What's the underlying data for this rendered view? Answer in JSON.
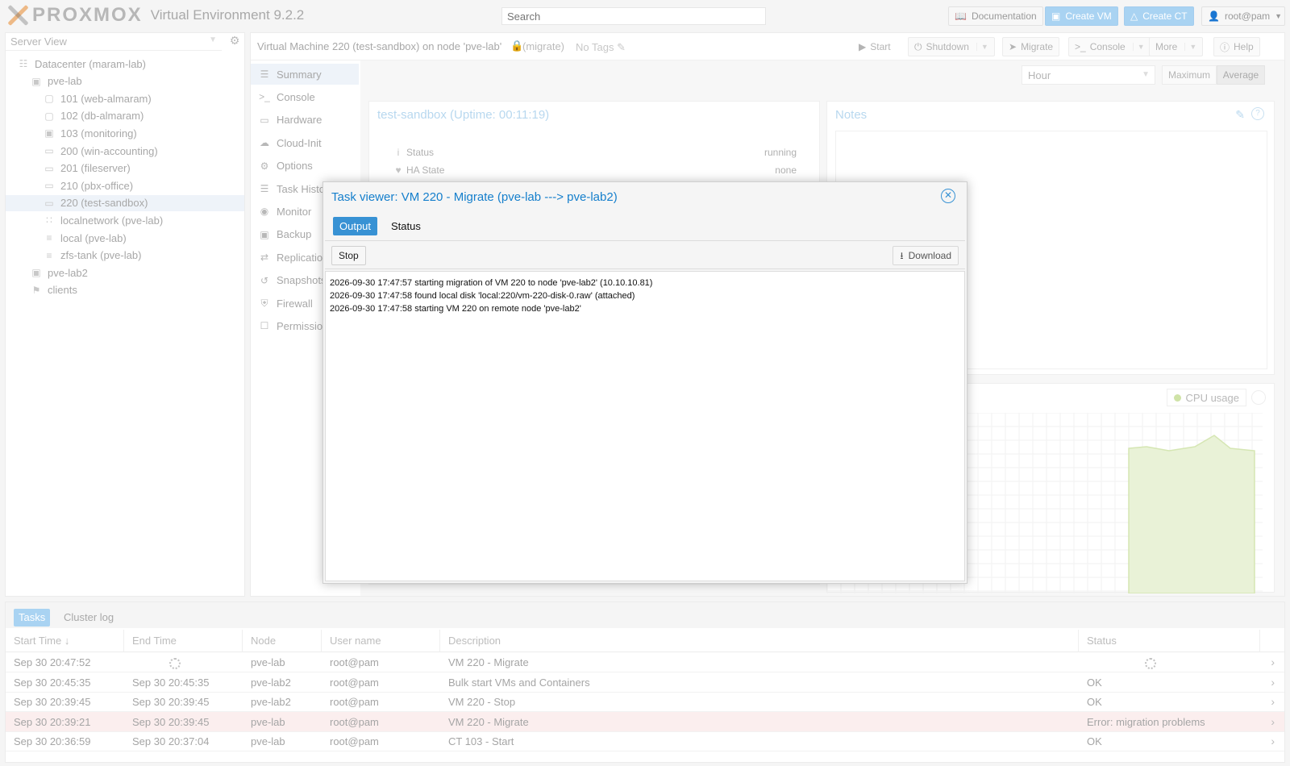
{
  "topbar": {
    "brand": "PROXMOX",
    "version": "Virtual Environment 9.2.2",
    "search_placeholder": "Search",
    "documentation": "Documentation",
    "create_vm": "Create VM",
    "create_ct": "Create CT",
    "user": "root@pam"
  },
  "tree": {
    "view": "Server View",
    "items": [
      {
        "label": "Datacenter (maram-lab)",
        "icon": "datacenter-icon"
      },
      {
        "label": "pve-lab",
        "icon": "node-online-icon"
      },
      {
        "label": "101 (web-almaram)",
        "icon": "container-icon"
      },
      {
        "label": "102 (db-almaram)",
        "icon": "container-icon"
      },
      {
        "label": "103 (monitoring)",
        "icon": "container-running-icon"
      },
      {
        "label": "200 (win-accounting)",
        "icon": "vm-icon"
      },
      {
        "label": "201 (fileserver)",
        "icon": "vm-icon"
      },
      {
        "label": "210 (pbx-office)",
        "icon": "vm-icon"
      },
      {
        "label": "220 (test-sandbox)",
        "icon": "vm-migrating-icon"
      },
      {
        "label": "localnetwork (pve-lab)",
        "icon": "network-icon"
      },
      {
        "label": "local (pve-lab)",
        "icon": "storage-icon"
      },
      {
        "label": "zfs-tank (pve-lab)",
        "icon": "storage-icon"
      },
      {
        "label": "pve-lab2",
        "icon": "node-online-icon"
      },
      {
        "label": "clients",
        "icon": "tag-icon"
      }
    ]
  },
  "vmheader": {
    "title": "Virtual Machine 220 (test-sandbox) on node 'pve-lab'",
    "lock": "(migrate)",
    "tags": "No Tags",
    "start": "Start",
    "shutdown": "Shutdown",
    "migrate": "Migrate",
    "console": "Console",
    "more": "More",
    "help": "Help"
  },
  "submenu": [
    "Summary",
    "Console",
    "Hardware",
    "Cloud-Init",
    "Options",
    "Task History",
    "Monitor",
    "Backup",
    "Replication",
    "Snapshots",
    "Firewall",
    "Permissions"
  ],
  "summary": {
    "timeframe": "Hour",
    "maximum": "Maximum",
    "average": "Average",
    "status_title": "test-sandbox (Uptime: 00:11:19)",
    "rows": [
      {
        "label": "Status",
        "value": "running"
      },
      {
        "label": "HA State",
        "value": "none"
      }
    ],
    "notes_title": "Notes",
    "cpu_legend": "CPU usage"
  },
  "tasks": {
    "tabs": [
      "Tasks",
      "Cluster log"
    ],
    "columns": [
      "Start Time ↓",
      "End Time",
      "Node",
      "User name",
      "Description",
      "Status"
    ],
    "rows": [
      {
        "start": "Sep 30 20:47:52",
        "end": "",
        "node": "pve-lab",
        "user": "root@pam",
        "desc": "VM 220 - Migrate",
        "status": "",
        "running": true
      },
      {
        "start": "Sep 30 20:45:35",
        "end": "Sep 30 20:45:35",
        "node": "pve-lab2",
        "user": "root@pam",
        "desc": "Bulk start VMs and Containers",
        "status": "OK"
      },
      {
        "start": "Sep 30 20:39:45",
        "end": "Sep 30 20:39:45",
        "node": "pve-lab2",
        "user": "root@pam",
        "desc": "VM 220 - Stop",
        "status": "OK"
      },
      {
        "start": "Sep 30 20:39:21",
        "end": "Sep 30 20:39:45",
        "node": "pve-lab",
        "user": "root@pam",
        "desc": "VM 220 - Migrate",
        "status": "Error: migration problems",
        "error": true
      },
      {
        "start": "Sep 30 20:36:59",
        "end": "Sep 30 20:37:04",
        "node": "pve-lab",
        "user": "root@pam",
        "desc": "CT 103 - Start",
        "status": "OK"
      }
    ]
  },
  "modal": {
    "title": "Task viewer: VM 220 - Migrate (pve-lab ---> pve-lab2)",
    "tab_output": "Output",
    "tab_status": "Status",
    "stop": "Stop",
    "download": "Download",
    "log": [
      "2026-09-30 17:47:57 starting migration of VM 220 to node 'pve-lab2' (10.10.10.81)",
      "2026-09-30 17:47:58 found local disk 'local:220/vm-220-disk-0.raw' (attached)",
      "2026-09-30 17:47:58 starting VM 220 on remote node 'pve-lab2'"
    ]
  },
  "colors": {
    "accent": "#3892d4",
    "title_blue": "#157fcc",
    "cpu_fill": "#e9f2d7"
  }
}
